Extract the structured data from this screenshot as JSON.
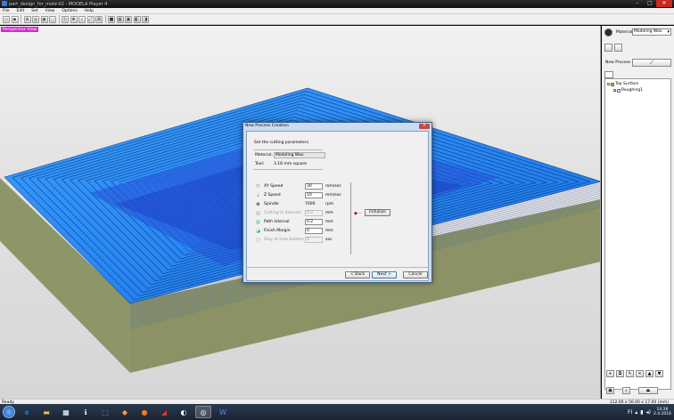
{
  "window": {
    "title": "part_design_for_mold-02 - MODELA Player 4",
    "controls": [
      "–",
      "□",
      "✕"
    ]
  },
  "menu": [
    "File",
    "Edit",
    "Set",
    "View",
    "Options",
    "Help"
  ],
  "viewport": {
    "view_tag": "Perspective View",
    "colors": {
      "toolpath": "#1e8fff",
      "stock": "#8b9366",
      "background": "#e0e0e0"
    }
  },
  "panel": {
    "material_label": "Material",
    "material_value": "Modeling Wax",
    "new_process_label": "New Process",
    "new_process_icon": "wand-icon",
    "tree": {
      "root": "Top Surface",
      "child": "Roughing1"
    }
  },
  "dialog": {
    "title": "New Process Creation",
    "close": "✕",
    "instruction": "Set the cutting parameters.",
    "material_label": "Material:",
    "material_value": "Modeling Wax",
    "tool_label": "Tool:",
    "tool_value": "3.18 mm square",
    "rows": [
      {
        "label": "XY Speed",
        "value": "30",
        "unit": "mm/sec",
        "enabled": true
      },
      {
        "label": "Z Speed",
        "value": "10",
        "unit": "mm/sec",
        "enabled": true
      },
      {
        "label": "Spindle",
        "value": "7000",
        "unit": "rpm",
        "enabled": true
      },
      {
        "label": "Cutting-in Amount",
        "value": "0.2",
        "unit": "mm",
        "enabled": false
      },
      {
        "label": "Path Interval",
        "value": "0.2",
        "unit": "mm",
        "enabled": true
      },
      {
        "label": "Finish Margin",
        "value": "0",
        "unit": "mm",
        "enabled": true
      },
      {
        "label": "Stay at hole bottom",
        "value": "0",
        "unit": "sec",
        "enabled": false
      }
    ],
    "initialize_label": "Initialize",
    "back_label": "< Back",
    "next_label": "Next >",
    "cancel_label": "Cancel"
  },
  "status": {
    "left": "Ready",
    "right": "112.00 x 56.00 x 17.00 (mm)"
  },
  "taskbar": {
    "clock_time": "14:26",
    "clock_date": "2.4.2016",
    "language": "FI"
  }
}
